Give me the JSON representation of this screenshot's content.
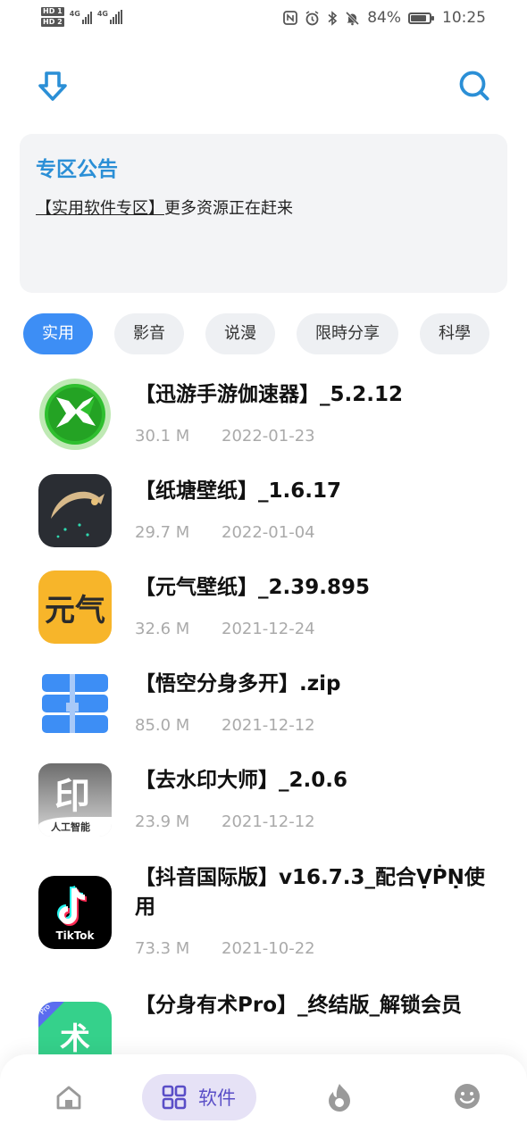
{
  "status_bar": {
    "sim1": "HD 1",
    "sim2": "HD 2",
    "net1": "4G",
    "net2": "4G",
    "battery_percent": "84%",
    "battery_level": 0.84,
    "time": "10:25"
  },
  "notice": {
    "title": "专区公告",
    "link_text": "【实用软件专区】",
    "body_text": "更多资源正在赶来"
  },
  "categories": [
    {
      "label": "实用",
      "active": true
    },
    {
      "label": "影音",
      "active": false
    },
    {
      "label": "说漫",
      "active": false
    },
    {
      "label": "限時分享",
      "active": false
    },
    {
      "label": "科學",
      "active": false
    }
  ],
  "apps": [
    {
      "title": "【迅游手游伽速器】_5.2.12",
      "size": "30.1 M",
      "date": "2022-01-23",
      "icon": "xunyou-icon"
    },
    {
      "title": "【纸塘壁纸】_1.6.17",
      "size": "29.7 M",
      "date": "2022-01-04",
      "icon": "zhitang-icon"
    },
    {
      "title": "【元气壁纸】_2.39.895",
      "size": "32.6 M",
      "date": "2021-12-24",
      "icon": "yuanqi-icon",
      "icon_text": "元气"
    },
    {
      "title": "【悟空分身多开】.zip",
      "size": "85.0 M",
      "date": "2021-12-12",
      "icon": "zip-archive-icon"
    },
    {
      "title": "【去水印大师】_2.0.6",
      "size": "23.9 M",
      "date": "2021-12-12",
      "icon": "watermark-icon",
      "icon_text": "印",
      "icon_subtext": "人工智能"
    },
    {
      "title": "【抖音国际版】v16.7.3_配合ṾṖṆ使用",
      "size": "73.3 M",
      "date": "2021-10-22",
      "icon": "tiktok-icon",
      "icon_text": "TikTok"
    },
    {
      "title": "【分身有术Pro】_终结版_解锁会员",
      "size": "",
      "date": "",
      "icon": "fenshen-icon",
      "icon_text": "术",
      "icon_badge": "Pro"
    }
  ],
  "bottom_nav": {
    "home_icon": "home-icon",
    "software_label": "软件",
    "discover_icon": "discover-icon",
    "profile_icon": "smiley-icon"
  },
  "colors": {
    "accent_blue": "#3d8ef5",
    "title_blue": "#2b8fd6",
    "nav_active_bg": "#e6e2f6",
    "nav_active_text": "#5a4ec7"
  }
}
